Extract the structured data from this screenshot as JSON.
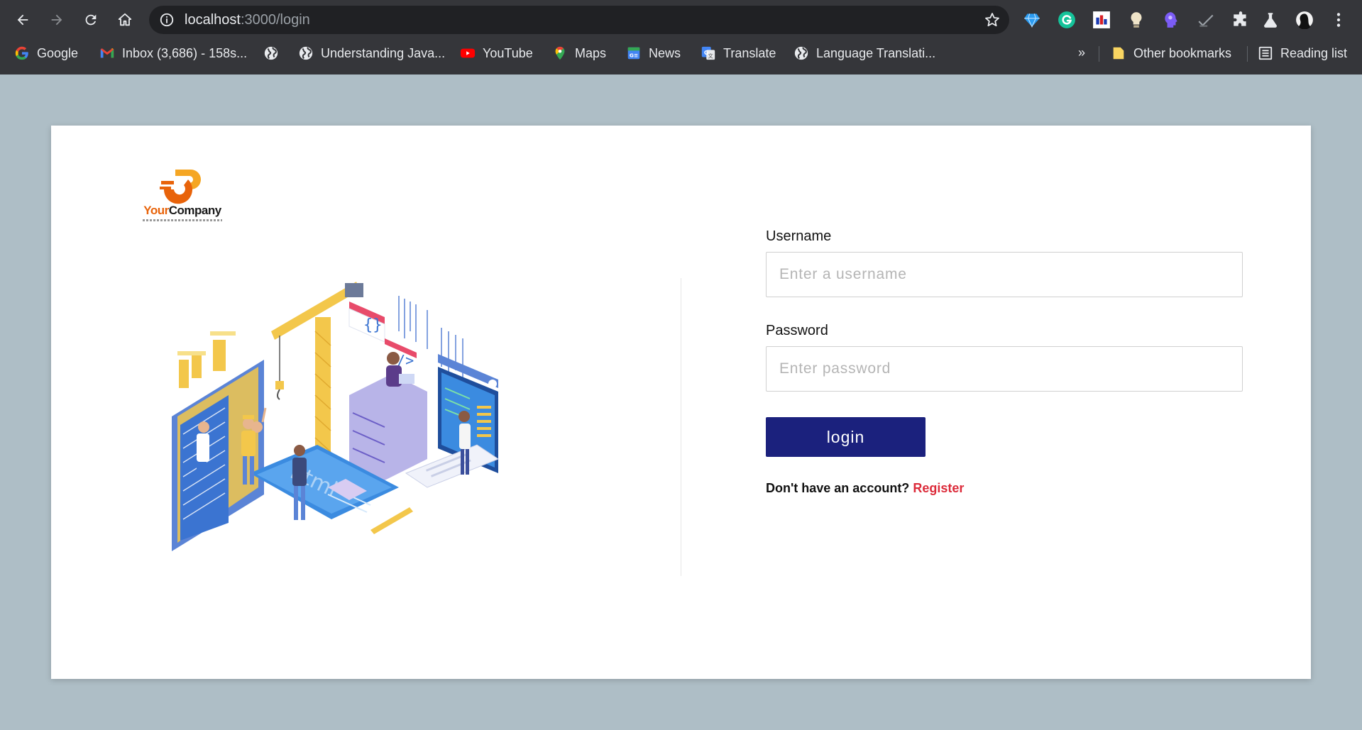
{
  "browser": {
    "url_host": "localhost",
    "url_path": ":3000/login",
    "bookmarks": [
      {
        "label": "Google",
        "icon": "google-icon"
      },
      {
        "label": "Inbox (3,686) - 158s...",
        "icon": "gmail-icon"
      },
      {
        "label": "",
        "icon": "globe-icon"
      },
      {
        "label": "Understanding Java...",
        "icon": "globe-icon"
      },
      {
        "label": "YouTube",
        "icon": "youtube-icon"
      },
      {
        "label": "Maps",
        "icon": "maps-icon"
      },
      {
        "label": "News",
        "icon": "news-icon"
      },
      {
        "label": "Translate",
        "icon": "translate-icon"
      },
      {
        "label": "Language Translati...",
        "icon": "globe-icon"
      }
    ],
    "more": "»",
    "other_bookmarks": "Other bookmarks",
    "reading_list": "Reading list"
  },
  "logo": {
    "part1": "Your",
    "part2": "Company"
  },
  "form": {
    "username_label": "Username",
    "username_placeholder": "Enter a username",
    "password_label": "Password",
    "password_placeholder": "Enter password",
    "login_label": "login",
    "no_account_text": "Don't have an account?",
    "register_label": "Register"
  },
  "colors": {
    "page_bg": "#aebec6",
    "button": "#1b217d",
    "register": "#dc2b3a",
    "logo_orange": "#e8630a"
  }
}
